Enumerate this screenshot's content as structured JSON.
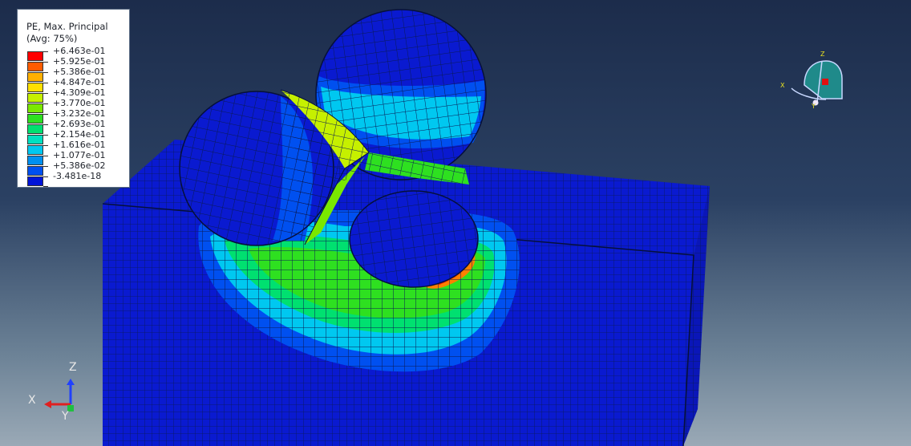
{
  "legend": {
    "variable": "PE, Max. Principal",
    "averaging": "(Avg: 75%)",
    "levels": [
      {
        "label": "+6.463e-01",
        "color": "#ff0000"
      },
      {
        "label": "+5.925e-01",
        "color": "#ff5c00"
      },
      {
        "label": "+5.386e-01",
        "color": "#ffb000"
      },
      {
        "label": "+4.847e-01",
        "color": "#ffe000"
      },
      {
        "label": "+4.309e-01",
        "color": "#c6f000"
      },
      {
        "label": "+3.770e-01",
        "color": "#7ae800"
      },
      {
        "label": "+3.232e-01",
        "color": "#2ee020"
      },
      {
        "label": "+2.693e-01",
        "color": "#00e070"
      },
      {
        "label": "+2.154e-01",
        "color": "#00e0c0"
      },
      {
        "label": "+1.616e-01",
        "color": "#00c8f0"
      },
      {
        "label": "+1.077e-01",
        "color": "#0090f0"
      },
      {
        "label": "+5.386e-02",
        "color": "#0050f0"
      },
      {
        "label": "-3.481e-18",
        "color": "#0014d8"
      }
    ]
  },
  "triad": {
    "x": "X",
    "y": "Y",
    "z": "Z"
  },
  "view_cube": {
    "x": "X",
    "z": "Z",
    "y": "Y"
  },
  "colors": {
    "block": "#0a1ad0",
    "mesh": "#0b1a55",
    "background_top": "#1c2c4b"
  }
}
